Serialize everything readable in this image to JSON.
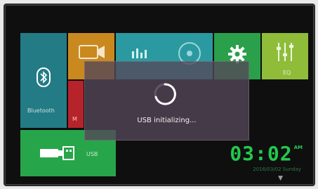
{
  "tiles": {
    "bluetooth": {
      "label": "Bluetooth",
      "icon": "bluetooth-icon",
      "color": "#237b86"
    },
    "mirror": {
      "label": "",
      "icon": "video-camera-icon",
      "color": "#c9891f"
    },
    "red_tile": {
      "label": "M",
      "color": "#b7232b"
    },
    "music": {
      "label": "",
      "icon": "equalizer-bars-icon",
      "color": "#2a9aa0"
    },
    "settings": {
      "label": "",
      "icon": "gear-icon",
      "color": "#2aa04a"
    },
    "eq": {
      "label": "EQ",
      "icon": "sliders-icon",
      "color": "#8fbd3a"
    },
    "usb": {
      "label": "USB",
      "icon": "usb-plug-icon",
      "color": "#27a54a"
    }
  },
  "dialog": {
    "message": "USB initializing..."
  },
  "clock": {
    "time": "03:02",
    "ampm": "AM",
    "date": "2016/03/02 Sunday"
  },
  "colors": {
    "accent_green": "#23c94b",
    "background": "#0f0f10"
  }
}
